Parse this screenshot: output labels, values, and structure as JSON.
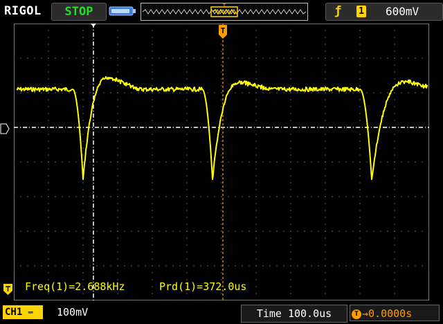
{
  "header": {
    "brand": "RIGOL",
    "run_state": "STOP",
    "trigger": {
      "edge_icon": "rising-edge-icon",
      "source": "1",
      "level": "600mV"
    },
    "trigger_marker": "T"
  },
  "measurements": {
    "freq_label": "Freq(1)=2.688kHz",
    "period_label": "Prd(1)=372.0us"
  },
  "footer": {
    "channel_label": "CH1",
    "channel_scale": "100mV",
    "time_label": "Time",
    "time_scale": "100.0us",
    "trigger_offset": "0.0000s"
  },
  "colors": {
    "trace": "#ffff00",
    "grid": "#7a7a7a",
    "state": "#22e022",
    "trigger": "#ff9c00",
    "channel": "#ffd400"
  }
}
